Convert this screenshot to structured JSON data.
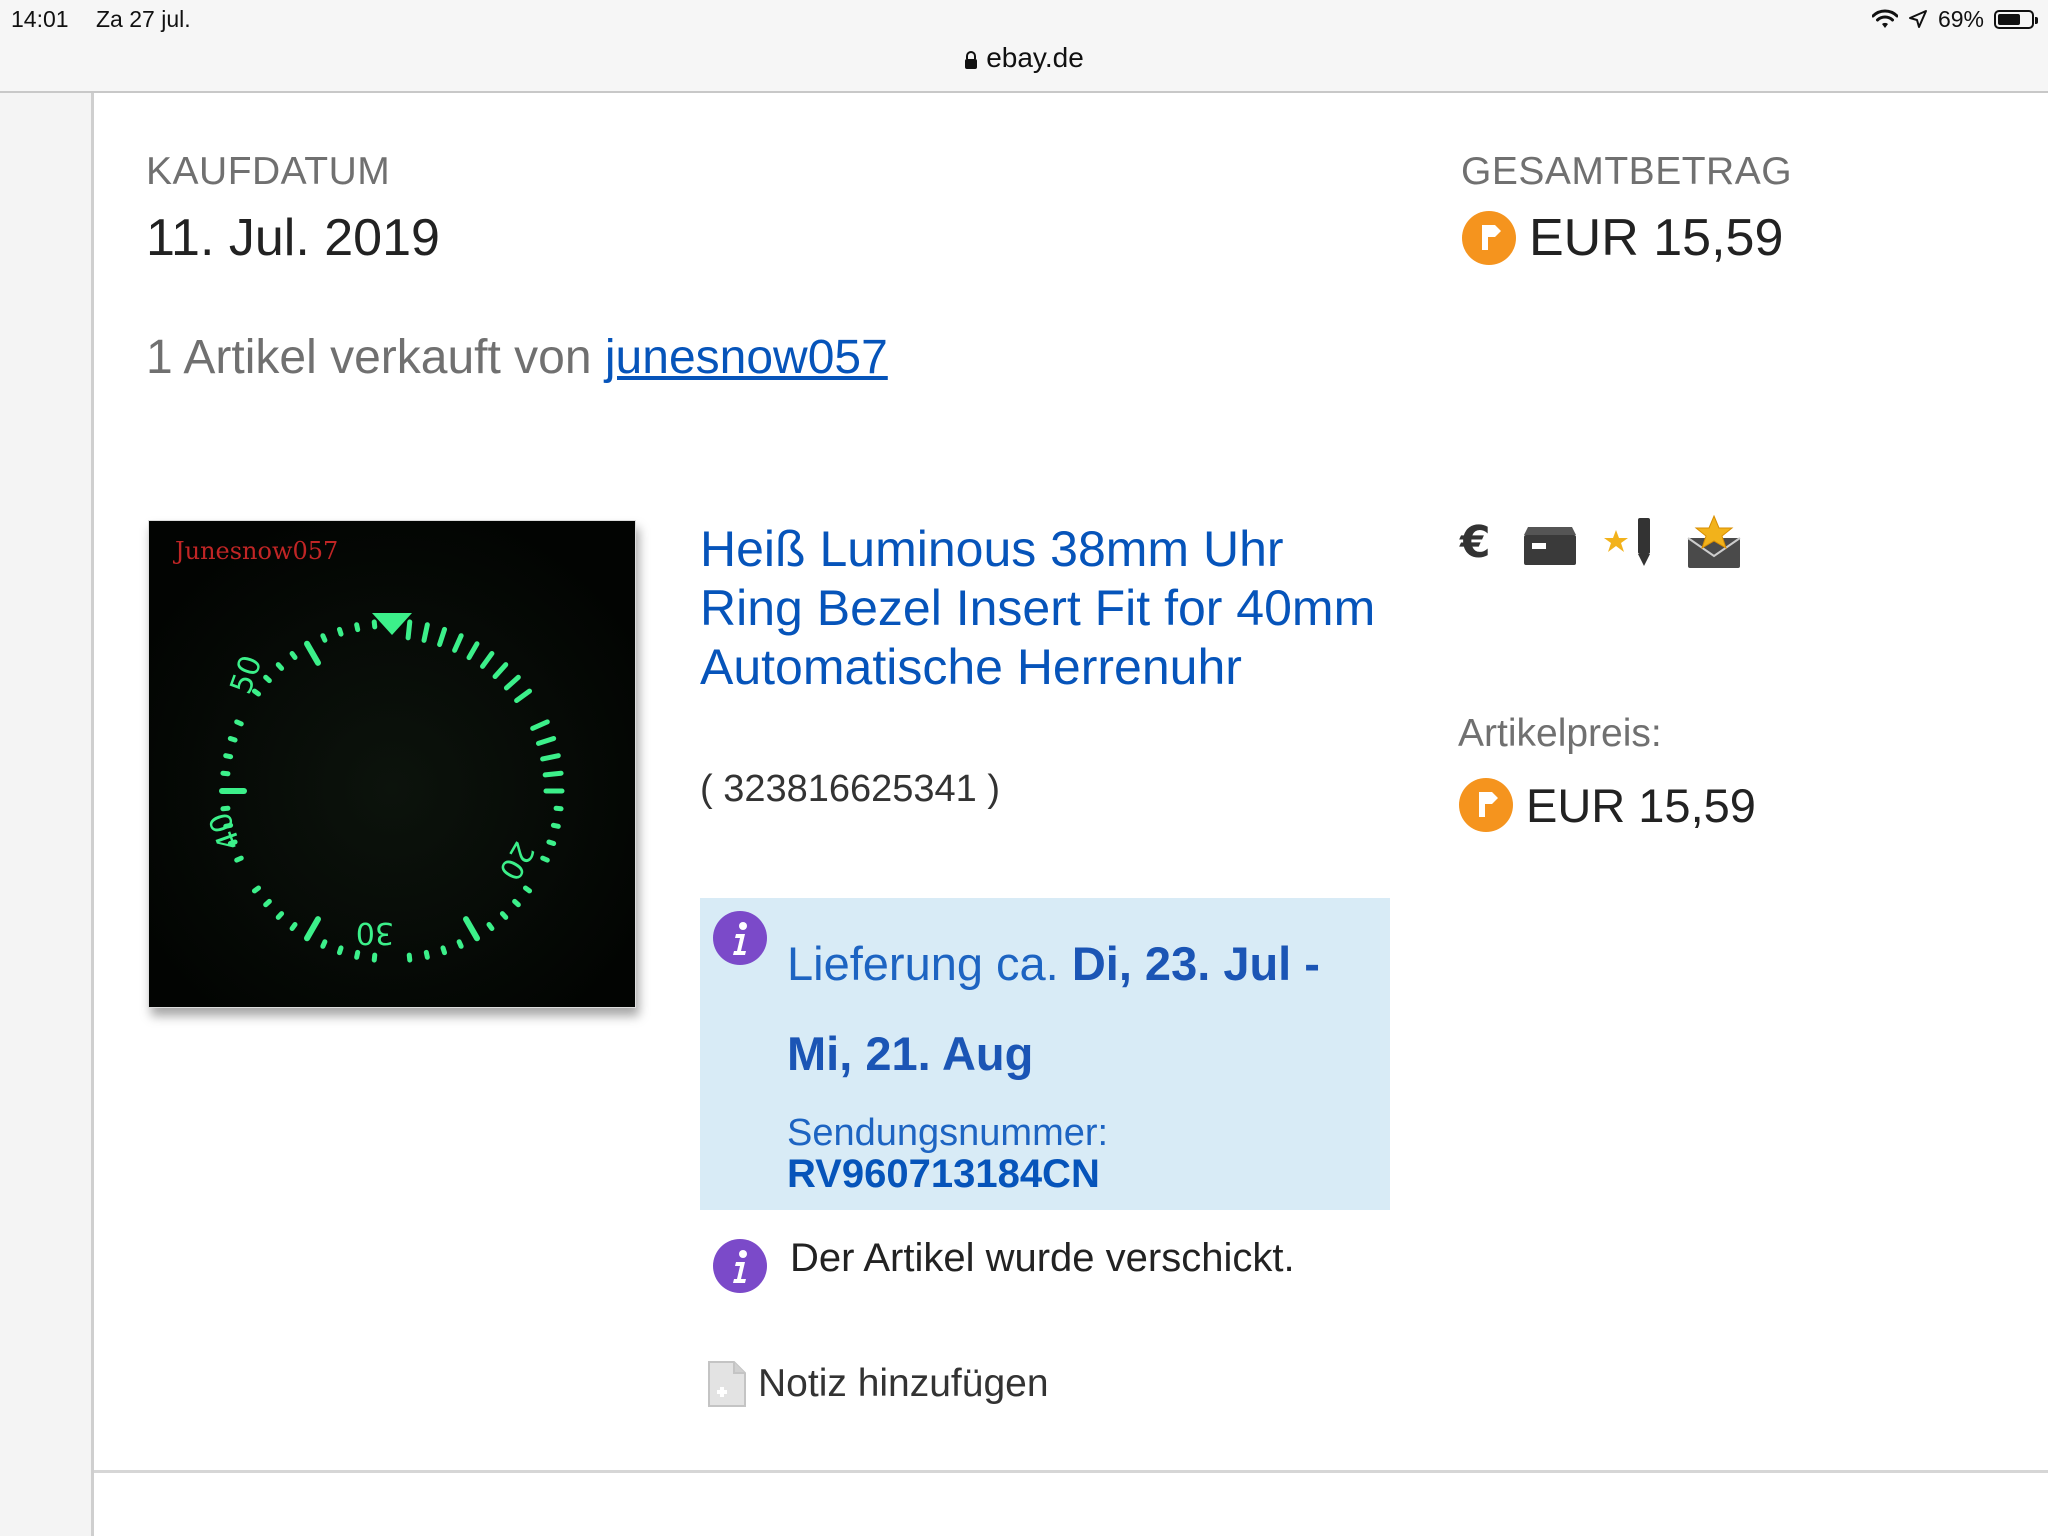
{
  "status_bar": {
    "time": "14:01",
    "date": "Za 27 jul.",
    "battery_percent_label": "69%",
    "battery_level": 0.69,
    "icons": [
      "wifi-icon",
      "location-arrow-icon",
      "battery-icon"
    ]
  },
  "address_bar": {
    "url": "ebay.de",
    "icon": "lock-icon"
  },
  "order": {
    "purchase_date_label": "KAUFDATUM",
    "purchase_date": "11. Jul. 2019",
    "total_label": "GESAMTBETRAG",
    "total": "EUR 15,59",
    "payment_icon": "orange-play-payment-icon",
    "seller_prefix": "1 Artikel verkauft von ",
    "seller_name": "junesnow057"
  },
  "item": {
    "image_watermark": "Junesnow057",
    "bezel_numbers": [
      "50",
      "40",
      "30",
      "20"
    ],
    "title": "Heiß Luminous 38mm Uhr Ring Bezel Insert Fit for 40mm Automatische Herrenuhr",
    "item_number": "( 323816625341 )",
    "price_label": "Artikelpreis:",
    "price": "EUR 15,59",
    "action_icons": [
      "euro-icon",
      "box-icon",
      "star-pencil-feedback-icon",
      "star-envelope-icon"
    ]
  },
  "delivery": {
    "prefix": "Lieferung ca. ",
    "range_start": "Di, 23. Jul -",
    "range_end": "Mi, 21. Aug",
    "tracking_label": "Sendungsnummer:",
    "tracking_number": "RV960713184CN"
  },
  "shipped_message": "Der Artikel wurde verschickt.",
  "add_note": "Notiz hinzufügen",
  "colors": {
    "link_blue": "#0654ba",
    "info_box_bg": "#d8ebf6",
    "info_icon_purple": "#7b4ac9",
    "payment_orange": "#f5941e",
    "bezel_green": "#3cf08a"
  }
}
